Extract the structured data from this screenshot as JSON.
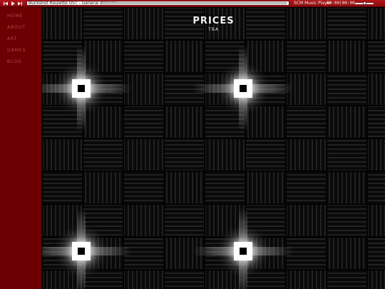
{
  "player": {
    "track_title": "Buckshot Roulette OST - General Release",
    "player_name": "SCM Music Player",
    "time": "00:00|00:00",
    "progress": 0.0,
    "volume": 0.5,
    "icons": [
      "previous-icon",
      "play-icon",
      "next-icon",
      "volume-slider"
    ]
  },
  "sidebar": {
    "items": [
      {
        "label": "Home"
      },
      {
        "label": "About"
      },
      {
        "label": "Art"
      },
      {
        "label": "Games"
      },
      {
        "label": "Blog"
      }
    ]
  },
  "main": {
    "title": "Prices",
    "subtitle": "TBA"
  },
  "colors": {
    "player_bar": "#9e1014",
    "sidebar": "#6a0002",
    "nav_text": "#b8494b",
    "background": "#050505"
  }
}
